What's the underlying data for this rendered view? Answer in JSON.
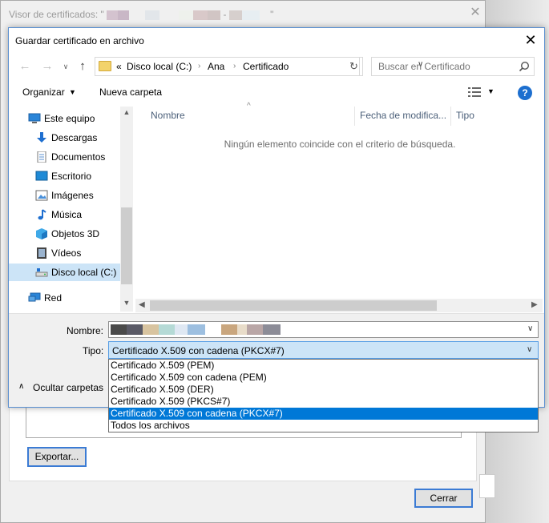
{
  "bg_window": {
    "title_prefix": "Visor de certificados: \"",
    "title_suffix": "\"",
    "export_label": "Exportar...",
    "close_label": "Cerrar"
  },
  "dialog": {
    "title": "Guardar certificado en archivo",
    "address": {
      "prefix": "«",
      "crumbs": [
        "Disco local (C:)",
        "Ana",
        "Certificado"
      ]
    },
    "search": {
      "placeholder": "Buscar en Certificado"
    },
    "toolbar": {
      "organize_label": "Organizar",
      "new_folder_label": "Nueva carpeta",
      "help_label": "?"
    },
    "nav": {
      "items": [
        {
          "label": "Este equipo",
          "icon": "computer-icon"
        },
        {
          "label": "Descargas",
          "icon": "downloads-icon"
        },
        {
          "label": "Documentos",
          "icon": "documents-icon"
        },
        {
          "label": "Escritorio",
          "icon": "desktop-icon"
        },
        {
          "label": "Imágenes",
          "icon": "pictures-icon"
        },
        {
          "label": "Música",
          "icon": "music-icon"
        },
        {
          "label": "Objetos 3D",
          "icon": "3d-objects-icon"
        },
        {
          "label": "Vídeos",
          "icon": "videos-icon"
        },
        {
          "label": "Disco local (C:)",
          "icon": "drive-icon",
          "selected": true
        },
        {
          "label": "Red",
          "icon": "network-icon"
        }
      ]
    },
    "columns": [
      "Nombre",
      "Fecha de modifica...",
      "Tipo"
    ],
    "empty_message": "Ningún elemento coincide con el criterio de búsqueda.",
    "filename_label": "Nombre:",
    "type_label": "Tipo:",
    "type_value": "Certificado X.509 con cadena (PKCX#7)",
    "hide_folders_label": "Ocultar carpetas",
    "type_options": [
      "Certificado X.509 (PEM)",
      "Certificado X.509 con cadena (PEM)",
      "Certificado X.509 (DER)",
      "Certificado X.509 (PKCS#7)",
      "Certificado X.509 con cadena (PKCX#7)",
      "Todos los archivos"
    ],
    "selected_type_index": 4
  }
}
